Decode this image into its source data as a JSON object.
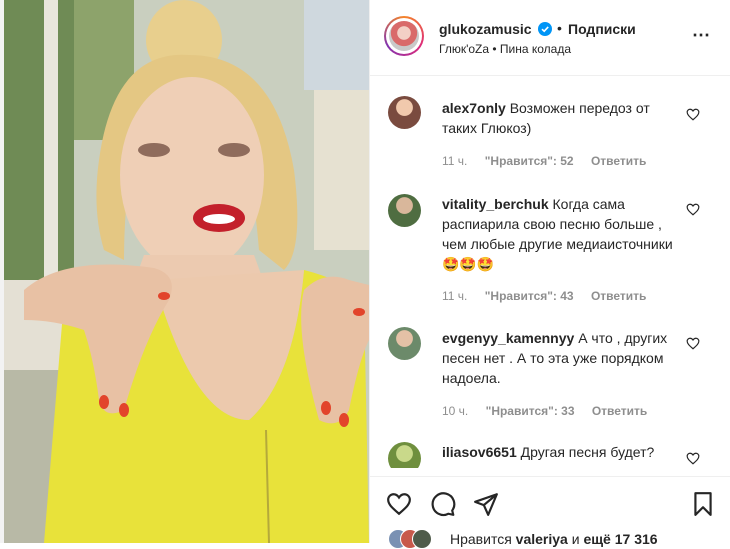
{
  "post": {
    "username": "glukozamusic",
    "separator": "•",
    "follow_label": "Подписки",
    "subline": "Глюк'oZa • Пина колада",
    "more_icon": "⋯"
  },
  "comments": [
    {
      "username": "alex7only",
      "text": "Возможен передоз от таких Глюкоз)",
      "time": "11 ч.",
      "likes": "\"Нравится\": 52",
      "reply": "Ответить",
      "avatar_color": "#8a5a48"
    },
    {
      "username": "vitality_berchuk",
      "text": "Когда сама распиарила свою песню больше , чем любые другие медиаисточники 🤩🤩🤩",
      "time": "11 ч.",
      "likes": "\"Нравится\": 43",
      "reply": "Ответить",
      "avatar_color": "#5f7f53"
    },
    {
      "username": "evgenyy_kamennyy",
      "text": "А что , других песен нет . А то эта уже порядком надоела.",
      "time": "10 ч.",
      "likes": "\"Нравится\": 33",
      "reply": "Ответить",
      "avatar_color": "#6c8a6a"
    },
    {
      "username": "iliasov6651",
      "text": "Другая песня будет?",
      "time": "",
      "likes": "",
      "reply": "",
      "avatar_color": "#6f8f3e"
    }
  ],
  "footer": {
    "likes_prefix": "Нравится",
    "likes_user": "valeriya",
    "likes_suffix": "и",
    "likes_count": "ещё 17 316"
  },
  "colors": {
    "accent_blue": "#0095f6",
    "text": "#262626",
    "muted": "#8e8e8e",
    "dress_yellow": "#e8e23a"
  }
}
